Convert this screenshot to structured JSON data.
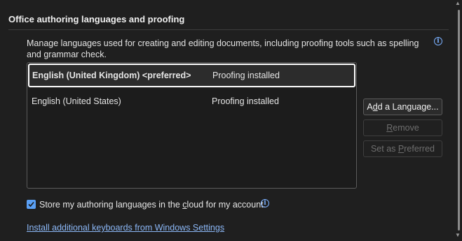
{
  "section": {
    "title": "Office authoring languages and proofing",
    "description": "Manage languages used for creating and editing documents, including proofing tools such as spelling and grammar check."
  },
  "languages": [
    {
      "name": "English (United Kingdom) <preferred>",
      "status": "Proofing installed",
      "selected": true
    },
    {
      "name": "English (United States)",
      "status": "Proofing installed",
      "selected": false
    }
  ],
  "buttons": {
    "add_pre": "A",
    "add_key": "d",
    "add_post": "d a Language...",
    "remove_pre": "",
    "remove_key": "R",
    "remove_post": "emove",
    "preferred_pre": "Set as ",
    "preferred_key": "P",
    "preferred_post": "referred"
  },
  "cloud_option": {
    "label_pre": "Store my authoring languages in the ",
    "label_key": "c",
    "label_post": "loud for my account.",
    "checked": true
  },
  "link": {
    "text": "Install additional keyboards from Windows Settings"
  },
  "colors": {
    "accent": "#5aa0f5",
    "link": "#8cb8f7",
    "background": "#1f1f1f"
  },
  "icons": {
    "info": "info-icon",
    "check": "checkmark-icon"
  }
}
